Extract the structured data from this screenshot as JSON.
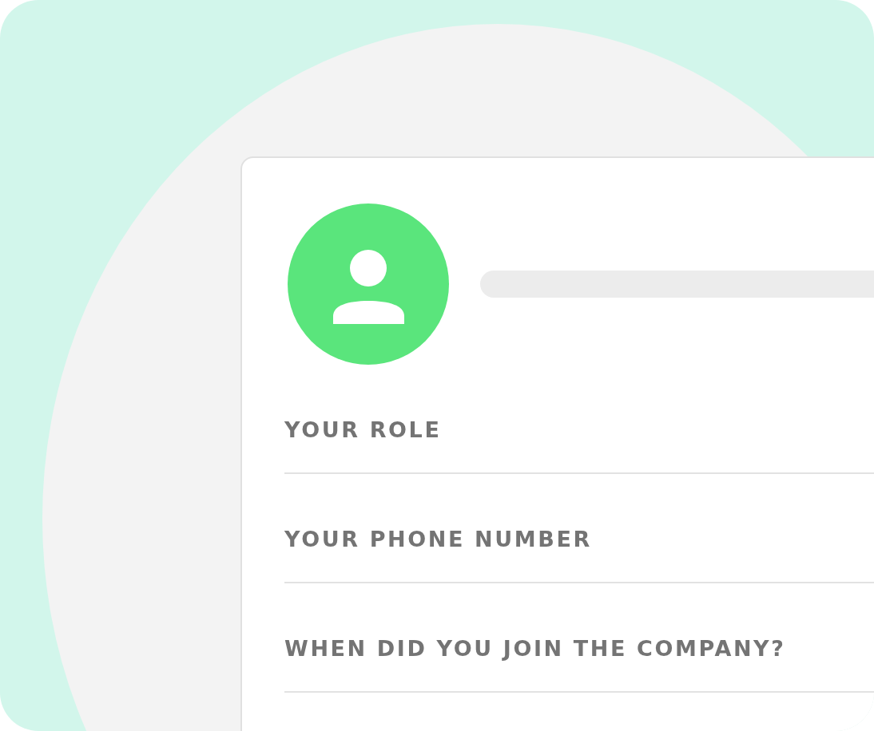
{
  "fields": [
    {
      "label": "YOUR ROLE"
    },
    {
      "label": "YOUR PHONE NUMBER"
    },
    {
      "label": "WHEN DID YOU JOIN THE COMPANY?"
    }
  ]
}
